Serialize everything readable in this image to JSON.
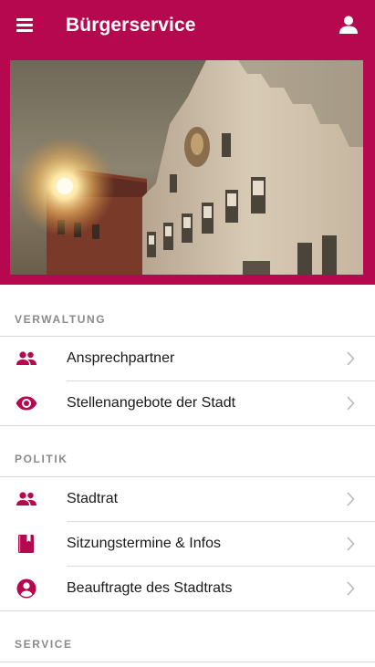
{
  "appbar": {
    "title": "Bürgerservice",
    "menu_icon": "menu-icon",
    "account_icon": "account-icon"
  },
  "hero": {
    "image": "town-hall-photo-with-sun"
  },
  "colors": {
    "accent": "#b5084e",
    "section_header_text": "#8a8a8a",
    "chevron": "#b8b8b8"
  },
  "sections": [
    {
      "header": "VERWALTUNG",
      "items": [
        {
          "label": "Ansprechpartner",
          "icon": "people-icon"
        },
        {
          "label": "Stellenangebote der Stadt",
          "icon": "eye-icon"
        }
      ]
    },
    {
      "header": "POLITIK",
      "items": [
        {
          "label": "Stadtrat",
          "icon": "people-icon"
        },
        {
          "label": "Sitzungstermine & Infos",
          "icon": "book-icon"
        },
        {
          "label": "Beauftragte des Stadtrats",
          "icon": "account-circle-icon"
        }
      ]
    },
    {
      "header": "SERVICE",
      "items": []
    }
  ]
}
